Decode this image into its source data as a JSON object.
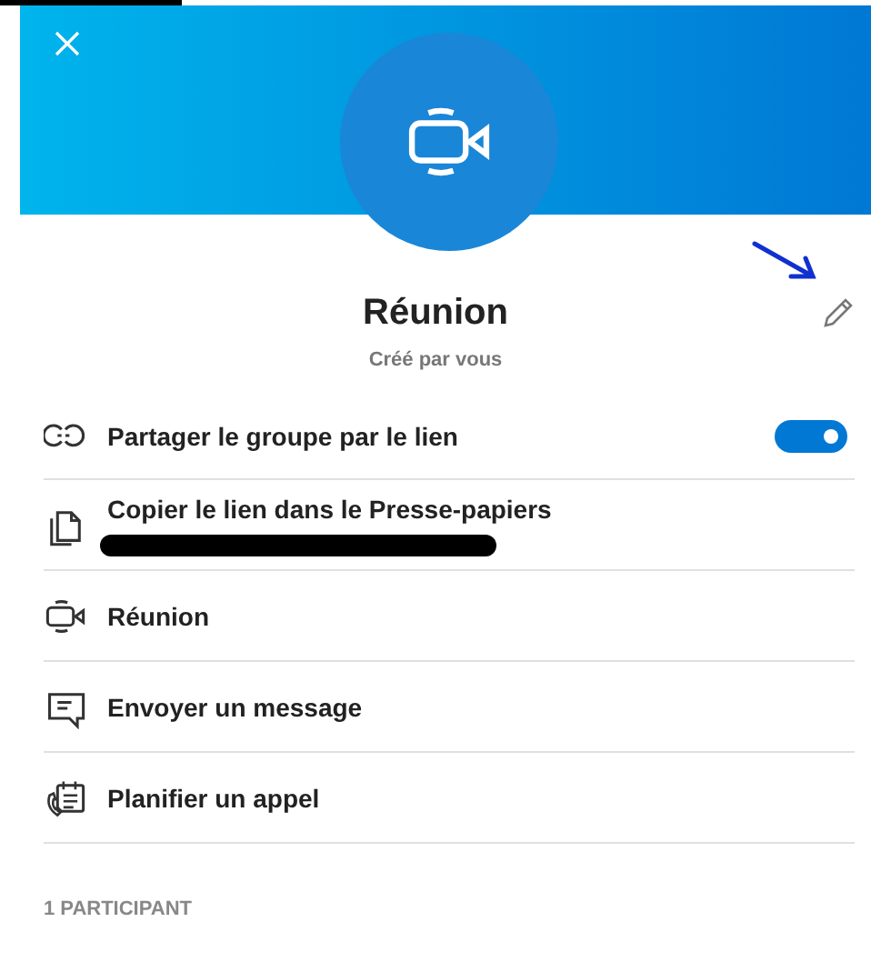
{
  "header": {
    "title": "Réunion",
    "subtitle": "Créé par vous"
  },
  "rows": [
    {
      "kind": "toggle",
      "label": "Partager le groupe par le lien",
      "on": true
    },
    {
      "kind": "action",
      "label": "Copier le lien dans le Presse-papiers",
      "redacted": true
    },
    {
      "kind": "action",
      "label": "Réunion"
    },
    {
      "kind": "action",
      "label": "Envoyer un message"
    },
    {
      "kind": "action",
      "label": "Planifier un appel"
    }
  ],
  "participants_heading": "1 PARTICIPANT"
}
